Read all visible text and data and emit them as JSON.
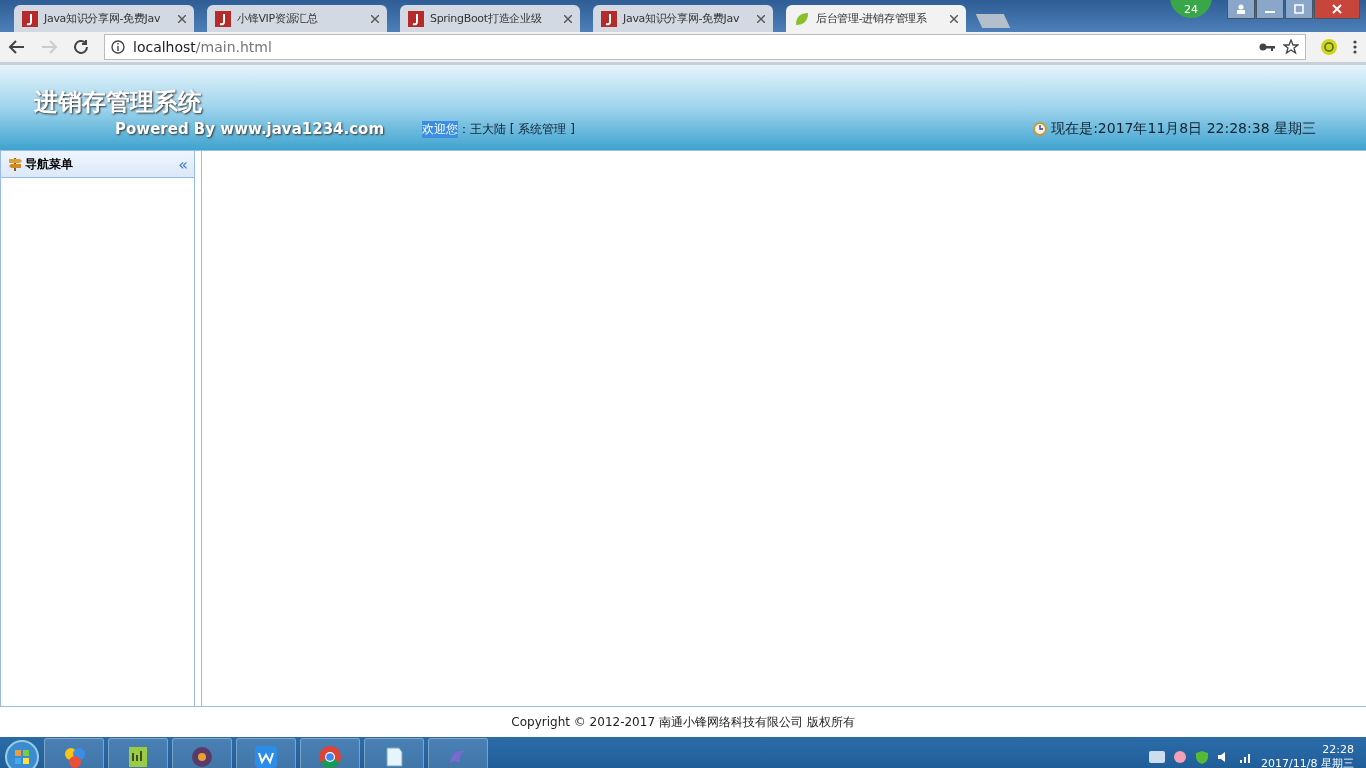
{
  "browser": {
    "tabs": [
      {
        "title": "Java知识分享网-免费Jav",
        "kind": "j",
        "selected": false
      },
      {
        "title": "小锋VIP资源汇总",
        "kind": "j",
        "selected": false
      },
      {
        "title": "SpringBoot打造企业级",
        "kind": "j",
        "selected": false
      },
      {
        "title": "Java知识分享网-免费Jav",
        "kind": "j",
        "selected": false
      },
      {
        "title": "后台管理-进销存管理系",
        "kind": "leaf",
        "selected": true
      }
    ],
    "badge": "24",
    "address": {
      "host": "localhost",
      "path": "/main.html"
    }
  },
  "header": {
    "title": "进销存管理系统",
    "powered": "Powered By www.java1234.com",
    "welcome": "欢迎您",
    "user": "：王大陆 [ 系统管理 ]",
    "clock": "现在是:2017年11月8日 22:28:38 星期三"
  },
  "nav": {
    "title": "导航菜单",
    "collapse": "«"
  },
  "footer": {
    "copyright": "Copyright © 2012-2017 南通小锋网络科技有限公司 版权所有"
  },
  "taskbar": {
    "time": "22:28",
    "date": "2017/11/8 星期三"
  }
}
